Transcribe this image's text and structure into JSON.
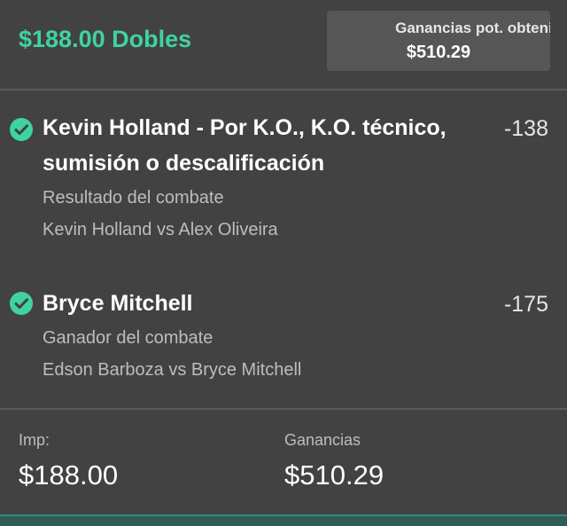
{
  "header": {
    "bet_title": "$188.00 Dobles",
    "potential_label": "Ganancias pot. obtenidas",
    "potential_value": "$510.29"
  },
  "selections": [
    {
      "name": "Kevin Holland - Por K.O., K.O. técnico, sumisión o descalificación",
      "odds": "-138",
      "market": "Resultado del combate",
      "event": "Kevin Holland vs Alex Oliveira",
      "status_icon": "check-circle-icon"
    },
    {
      "name": "Bryce Mitchell",
      "odds": "-175",
      "market": "Ganador del combate",
      "event": "Edson Barboza vs Bryce Mitchell",
      "status_icon": "check-circle-icon"
    }
  ],
  "footer": {
    "stake_label": "Imp:",
    "stake_value": "$188.00",
    "returns_label": "Ganancias",
    "returns_value": "$510.29"
  },
  "colors": {
    "accent": "#3fd3a4",
    "background": "#424242",
    "box": "#565656"
  }
}
